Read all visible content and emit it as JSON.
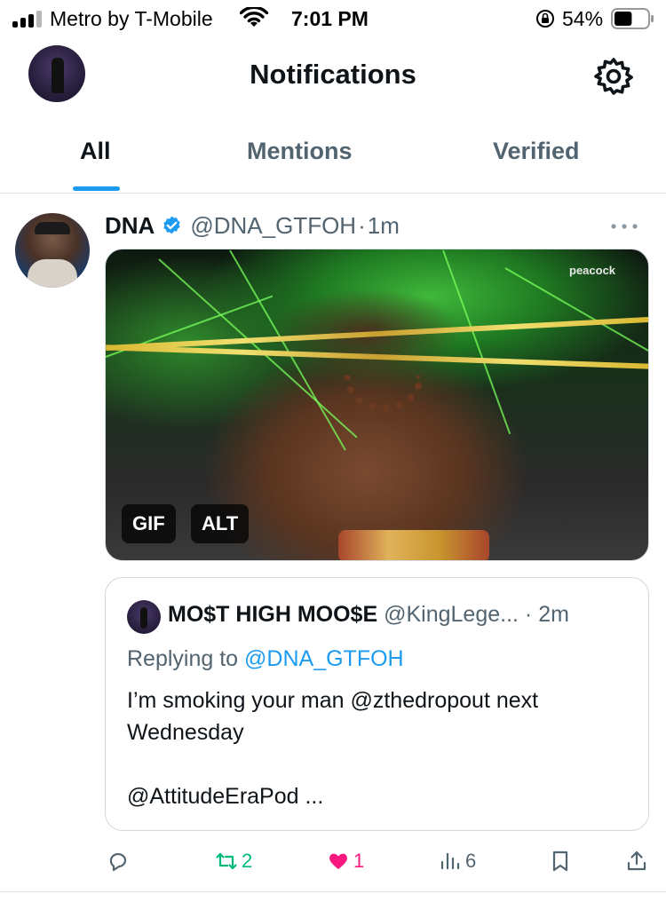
{
  "status_bar": {
    "carrier": "Metro by T-Mobile",
    "time": "7:01 PM",
    "battery": "54%",
    "battery_level": 0.54
  },
  "header": {
    "title": "Notifications",
    "settings_icon": "gear-icon"
  },
  "tabs": [
    {
      "label": "All",
      "active": true
    },
    {
      "label": "Mentions",
      "active": false
    },
    {
      "label": "Verified",
      "active": false
    }
  ],
  "tweet": {
    "author_name": "DNA",
    "handle": "@DNA_GTFOH",
    "separator": "·",
    "time": "1m",
    "media": {
      "brand": "peacock",
      "badges": [
        "GIF",
        "ALT"
      ]
    },
    "quote": {
      "author_name": "MO$T HIGH MOO$E",
      "handle": "@KingLege...",
      "separator": "·",
      "time": "2m",
      "replying_prefix": "Replying to ",
      "replying_handle": "@DNA_GTFOH",
      "text_line1": "I’m smoking your man @zthedropout next Wednesday",
      "text_line2": "@AttitudeEraPod ..."
    },
    "actions": {
      "reply_count": "",
      "retweet_count": "2",
      "like_count": "1",
      "views_count": "6"
    },
    "colors": {
      "accent": "#1d9bf0",
      "retweet": "#00ba7c",
      "like": "#f91880",
      "muted": "#536471"
    }
  }
}
